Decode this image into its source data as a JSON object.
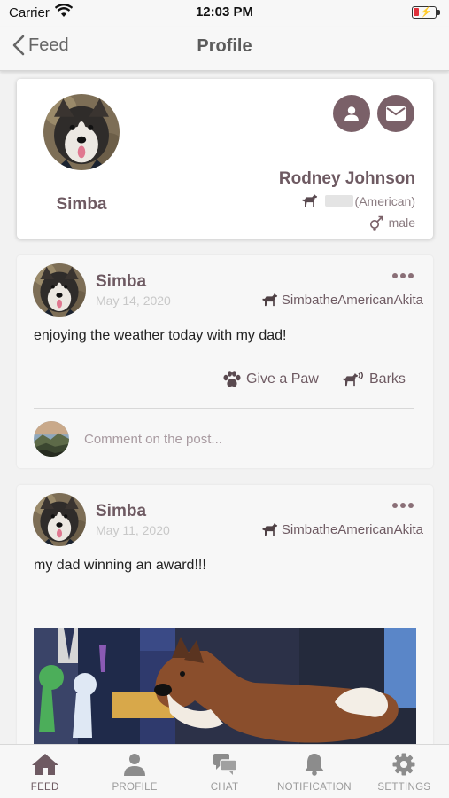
{
  "status_bar": {
    "carrier": "Carrier",
    "time": "12:03 PM"
  },
  "nav": {
    "back_label": "Feed",
    "title": "Profile"
  },
  "profile": {
    "pet_name": "Simba",
    "owner_name": "Rodney Johnson",
    "breed": "(American)",
    "gender": "male",
    "actions": [
      {
        "icon": "person-icon"
      },
      {
        "icon": "envelope-icon"
      }
    ]
  },
  "posts": [
    {
      "author": "Simba",
      "date": "May 14, 2020",
      "handle": "SimbatheAmericanAkita",
      "text": "enjoying the weather today with my dad!",
      "give_paw_label": "Give a Paw",
      "barks_label": "Barks",
      "comment_placeholder": "Comment on the post..."
    },
    {
      "author": "Simba",
      "date": "May 11, 2020",
      "handle": "SimbatheAmericanAkita",
      "text": "my dad winning an award!!!"
    }
  ],
  "tabs": [
    {
      "label": "FEED",
      "icon": "home-icon",
      "active": true
    },
    {
      "label": "PROFILE",
      "icon": "person-icon",
      "active": false
    },
    {
      "label": "CHAT",
      "icon": "chat-icon",
      "active": false
    },
    {
      "label": "NOTIFICATION",
      "icon": "bell-icon",
      "active": false
    },
    {
      "label": "SETTINGS",
      "icon": "gear-icon",
      "active": false
    }
  ],
  "colors": {
    "accent": "#6e5a62",
    "button_bg": "#7a6068",
    "muted_text": "#8a7b80",
    "date_text": "#c8c8c8",
    "battery_low": "#e0303a"
  }
}
